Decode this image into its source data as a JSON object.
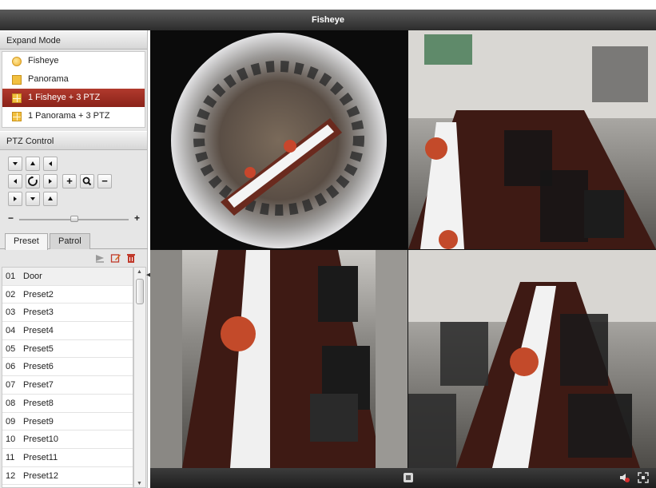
{
  "window": {
    "title": "Fisheye"
  },
  "expand_mode": {
    "header": "Expand Mode",
    "items": [
      {
        "label": "Fisheye",
        "icon": "fisheye-icon"
      },
      {
        "label": "Panorama",
        "icon": "panorama-icon"
      },
      {
        "label": "1 Fisheye + 3 PTZ",
        "icon": "grid-icon",
        "selected": true
      },
      {
        "label": "1 Panorama + 3 PTZ",
        "icon": "grid-icon"
      }
    ]
  },
  "ptz_control": {
    "header": "PTZ Control",
    "slider_minus": "−",
    "slider_plus": "+",
    "zoom_in": "+",
    "zoom_out": "−"
  },
  "tabs": [
    {
      "label": "Preset",
      "active": true
    },
    {
      "label": "Patrol",
      "active": false
    }
  ],
  "presets": [
    {
      "num": "01",
      "name": "Door"
    },
    {
      "num": "02",
      "name": "Preset2"
    },
    {
      "num": "03",
      "name": "Preset3"
    },
    {
      "num": "04",
      "name": "Preset4"
    },
    {
      "num": "05",
      "name": "Preset5"
    },
    {
      "num": "06",
      "name": "Preset6"
    },
    {
      "num": "07",
      "name": "Preset7"
    },
    {
      "num": "08",
      "name": "Preset8"
    },
    {
      "num": "09",
      "name": "Preset9"
    },
    {
      "num": "10",
      "name": "Preset10"
    },
    {
      "num": "11",
      "name": "Preset11"
    },
    {
      "num": "12",
      "name": "Preset12"
    }
  ],
  "colors": {
    "selected": "#9e2e22",
    "titlebar": "#3a3a3a",
    "panel": "#e6e6e6"
  }
}
